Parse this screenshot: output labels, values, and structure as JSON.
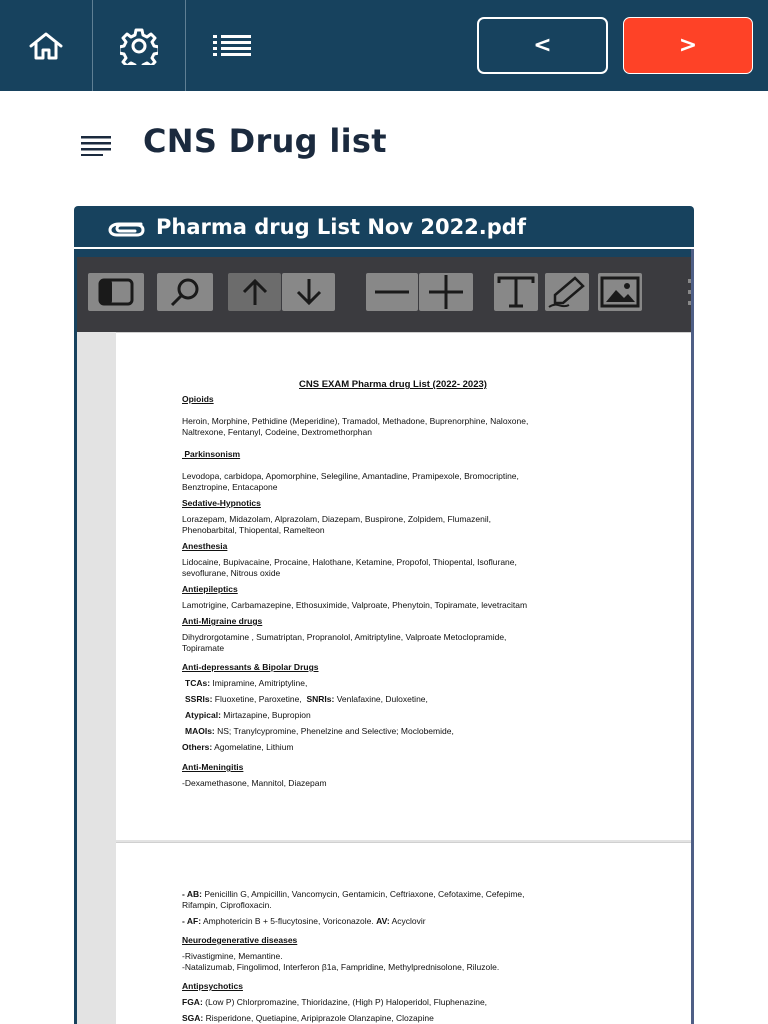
{
  "nav": {
    "home_icon": "home-icon",
    "settings_icon": "gear-icon",
    "menu_icon": "list-icon",
    "prev_label": "<",
    "next_label": ">",
    "bar_color": "#17425e",
    "next_color": "#fe4227"
  },
  "page": {
    "title": "CNS Drug list",
    "title_icon": "lines-icon"
  },
  "attachment": {
    "icon": "paperclip-icon",
    "filename": "Pharma drug List Nov 2022.pdf"
  },
  "viewer": {
    "toolbar": [
      "sidebar-toggle-icon",
      "search-icon",
      "arrow-up-icon",
      "arrow-down-icon",
      "zoom-out-icon",
      "zoom-in-icon",
      "text-icon",
      "draw-icon",
      "image-icon"
    ]
  },
  "document": {
    "title": "CNS EXAM Pharma drug List (2022- 2023)",
    "opioids_h": "Opioids",
    "opioids_1": "Heroin, Morphine, Pethidine (Meperidine), Tramadol, Methadone, Buprenorphine, Naloxone,",
    "opioids_2": "Naltrexone, Fentanyl, Codeine, Dextromethorphan",
    "parkinson_h": " Parkinsonism",
    "parkinson_1": "Levodopa, carbidopa, Apomorphine, Selegiline, Amantadine, Pramipexole, Bromocriptine,",
    "parkinson_2": "Benztropine, Entacapone",
    "sedative_h": "Sedative-Hypnotics",
    "sedative_1": "Lorazepam, Midazolam, Alprazolam, Diazepam, Buspirone, Zolpidem, Flumazenil,",
    "sedative_2": "Phenobarbital, Thiopental, Ramelteon",
    "anesth_h": "Anesthesia",
    "anesth_1": "Lidocaine, Bupivacaine, Procaine, Halothane, Ketamine, Propofol, Thiopental, Isoflurane,",
    "anesth_2": "sevoflurane, Nitrous oxide",
    "antiepi_h": "Antiepileptics",
    "antiepi_1": "Lamotrigine, Carbamazepine, Ethosuximide, Valproate, Phenytoin, Topiramate, levetracitam",
    "migraine_h": "Anti-Migraine drugs",
    "migraine_1": "Dihydrorgotamine , Sumatriptan, Propranolol, Amitriptyline, Valproate Metoclopramide,",
    "migraine_2": "Topiramate",
    "antidep_h": "Anti-depressants & Bipolar Drugs",
    "tca_label": "TCAs:",
    "tca_text": " Imipramine, Amitriptyline,",
    "ssri_label": "SSRIs:",
    "ssri_text": " Fluoxetine, Paroxetine,",
    "snri_label": "SNRIs:",
    "snri_text": " Venlafaxine, Duloxetine,",
    "atyp_label": "Atypical:",
    "atyp_text": " Mirtazapine, Bupropion",
    "maoi_label": "MAOIs:",
    "maoi_text": " NS; Tranylcypromine, Phenelzine and Selective; Moclobemide,",
    "others_label": "Others:",
    "others_text": " Agomelatine, Lithium",
    "mening_h": "Anti-Meningitis",
    "mening_1": "-Dexamethasone, Mannitol, Diazepam",
    "ab_label": "- AB:",
    "ab_text": " Penicillin G, Ampicillin, Vancomycin, Gentamicin, Ceftriaxone, Cefotaxime, Cefepime,",
    "ab_2": "Rifampin, Ciprofloxacin.",
    "af_label": "- AF:",
    "af_text": " Amphotericin B + 5-flucytosine, Voriconazole.",
    "av_label": "AV:",
    "av_text": " Acyclovir",
    "neuro_h": "Neurodegenerative diseases",
    "neuro_1": "-Rivastigmine, Memantine.",
    "neuro_2": "-Natalizumab, Fingolimod, Interferon β1a, Fampridine, Methylprednisolone, Riluzole.",
    "antipsy_h": "Antipsychotics",
    "fga_label": "FGA:",
    "fga_text": " (Low P) Chlorpromazine, Thioridazine, (High P) Haloperidol, Fluphenazine,",
    "sga_label": "SGA:",
    "sga_text": " Risperidone, Quetiapine, Aripiprazole Olanzapine, Clozapine"
  }
}
